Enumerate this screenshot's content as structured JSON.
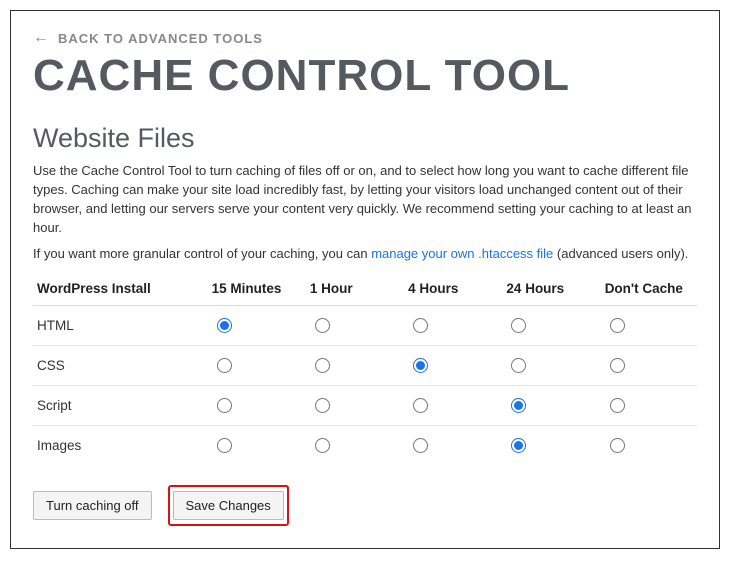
{
  "nav": {
    "back_label": "BACK TO ADVANCED TOOLS"
  },
  "header": {
    "title": "CACHE CONTROL TOOL"
  },
  "section": {
    "title": "Website Files",
    "desc1": "Use the Cache Control Tool to turn caching of files off or on, and to select how long you want to cache different file types. Caching can make your site load incredibly fast, by letting your visitors load unchanged content out of their browser, and letting our servers serve your content very quickly. We recommend setting your caching to at least an hour.",
    "desc2_before": "If you want more granular control of your caching, you can ",
    "desc2_link": "manage your own .htaccess file",
    "desc2_after": " (advanced users only)."
  },
  "table": {
    "columns": [
      "WordPress Install",
      "15 Minutes",
      "1 Hour",
      "4 Hours",
      "24 Hours",
      "Don't Cache"
    ],
    "rows": [
      {
        "label": "HTML",
        "selected": 0
      },
      {
        "label": "CSS",
        "selected": 2
      },
      {
        "label": "Script",
        "selected": 3
      },
      {
        "label": "Images",
        "selected": 3
      }
    ]
  },
  "buttons": {
    "caching_off": "Turn caching off",
    "save": "Save Changes"
  }
}
